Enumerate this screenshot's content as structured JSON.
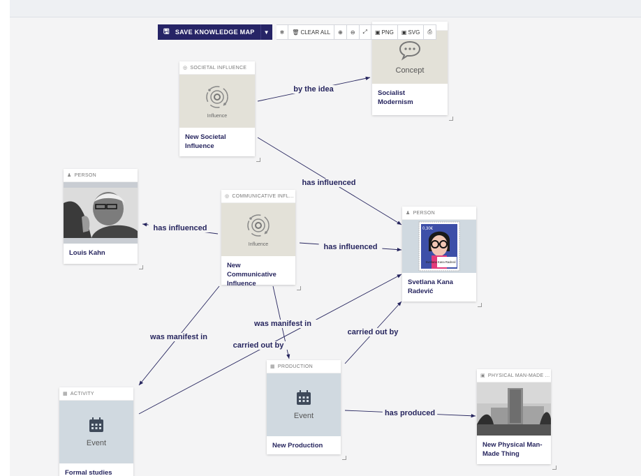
{
  "toolbar": {
    "save_label": "SAVE KNOWLEDGE MAP",
    "clear_label": "CLEAR ALL",
    "png_label": "PNG",
    "svg_label": "SVG"
  },
  "nodes": {
    "societal": {
      "type": "SOCIETAL INFLUENCE",
      "caption": "Influence",
      "label": "New Societal Influence"
    },
    "concept": {
      "caption": "Concept",
      "label": "Socialist Modernism"
    },
    "kahn": {
      "type": "PERSON",
      "label": "Louis Kahn"
    },
    "communicative": {
      "type": "COMMUNICATIVE INFL...",
      "caption": "Influence",
      "label": "New Communicative Influence"
    },
    "svetlana": {
      "type": "PERSON",
      "label": "Svetlana Kana Radević",
      "stamp_price": "0,30€",
      "stamp_name": "Svetlana Kana Radević"
    },
    "activity": {
      "type": "ACTIVITY",
      "caption": "Event",
      "label": "Formal studies"
    },
    "production": {
      "type": "PRODUCTION",
      "caption": "Event",
      "label": "New Production"
    },
    "physical": {
      "type": "PHYSICAL MAN-MADE ...",
      "label": "New Physical Man-Made Thing"
    }
  },
  "edges": [
    {
      "label": "by the idea"
    },
    {
      "label": "has influenced"
    },
    {
      "label": "has influenced"
    },
    {
      "label": "has influenced"
    },
    {
      "label": "was manifest in"
    },
    {
      "label": "was manifest in"
    },
    {
      "label": "carried out by"
    },
    {
      "label": "carried out by"
    },
    {
      "label": "has produced"
    }
  ],
  "colors": {
    "accent": "#262466",
    "edge": "#26255e",
    "beige": "#e3e1d8",
    "blue": "#d0d9e0"
  }
}
